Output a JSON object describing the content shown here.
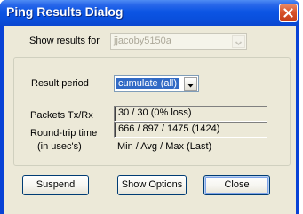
{
  "window": {
    "title": "Ping Results Dialog",
    "close_icon": "close-icon"
  },
  "show_results": {
    "label": "Show results for",
    "value": "jjacoby5150a",
    "disabled": true
  },
  "result_period": {
    "label": "Result period",
    "value": "cumulate (all)"
  },
  "packets": {
    "label": "Packets Tx/Rx",
    "value": "30 / 30  (0% loss)"
  },
  "rtt": {
    "label": "Round-trip time",
    "sublabel": "(in usec's)",
    "value": "666 / 897 / 1475 (1424)",
    "legend": "Min  / Avg  / Max   (Last)"
  },
  "buttons": {
    "suspend": "Suspend",
    "show_options": "Show Options",
    "close": "Close"
  },
  "colors": {
    "title_bar": "#0a4fdc",
    "dialog_face": "#ece9d8",
    "selection": "#316ac5",
    "close_button": "#d8532b"
  }
}
